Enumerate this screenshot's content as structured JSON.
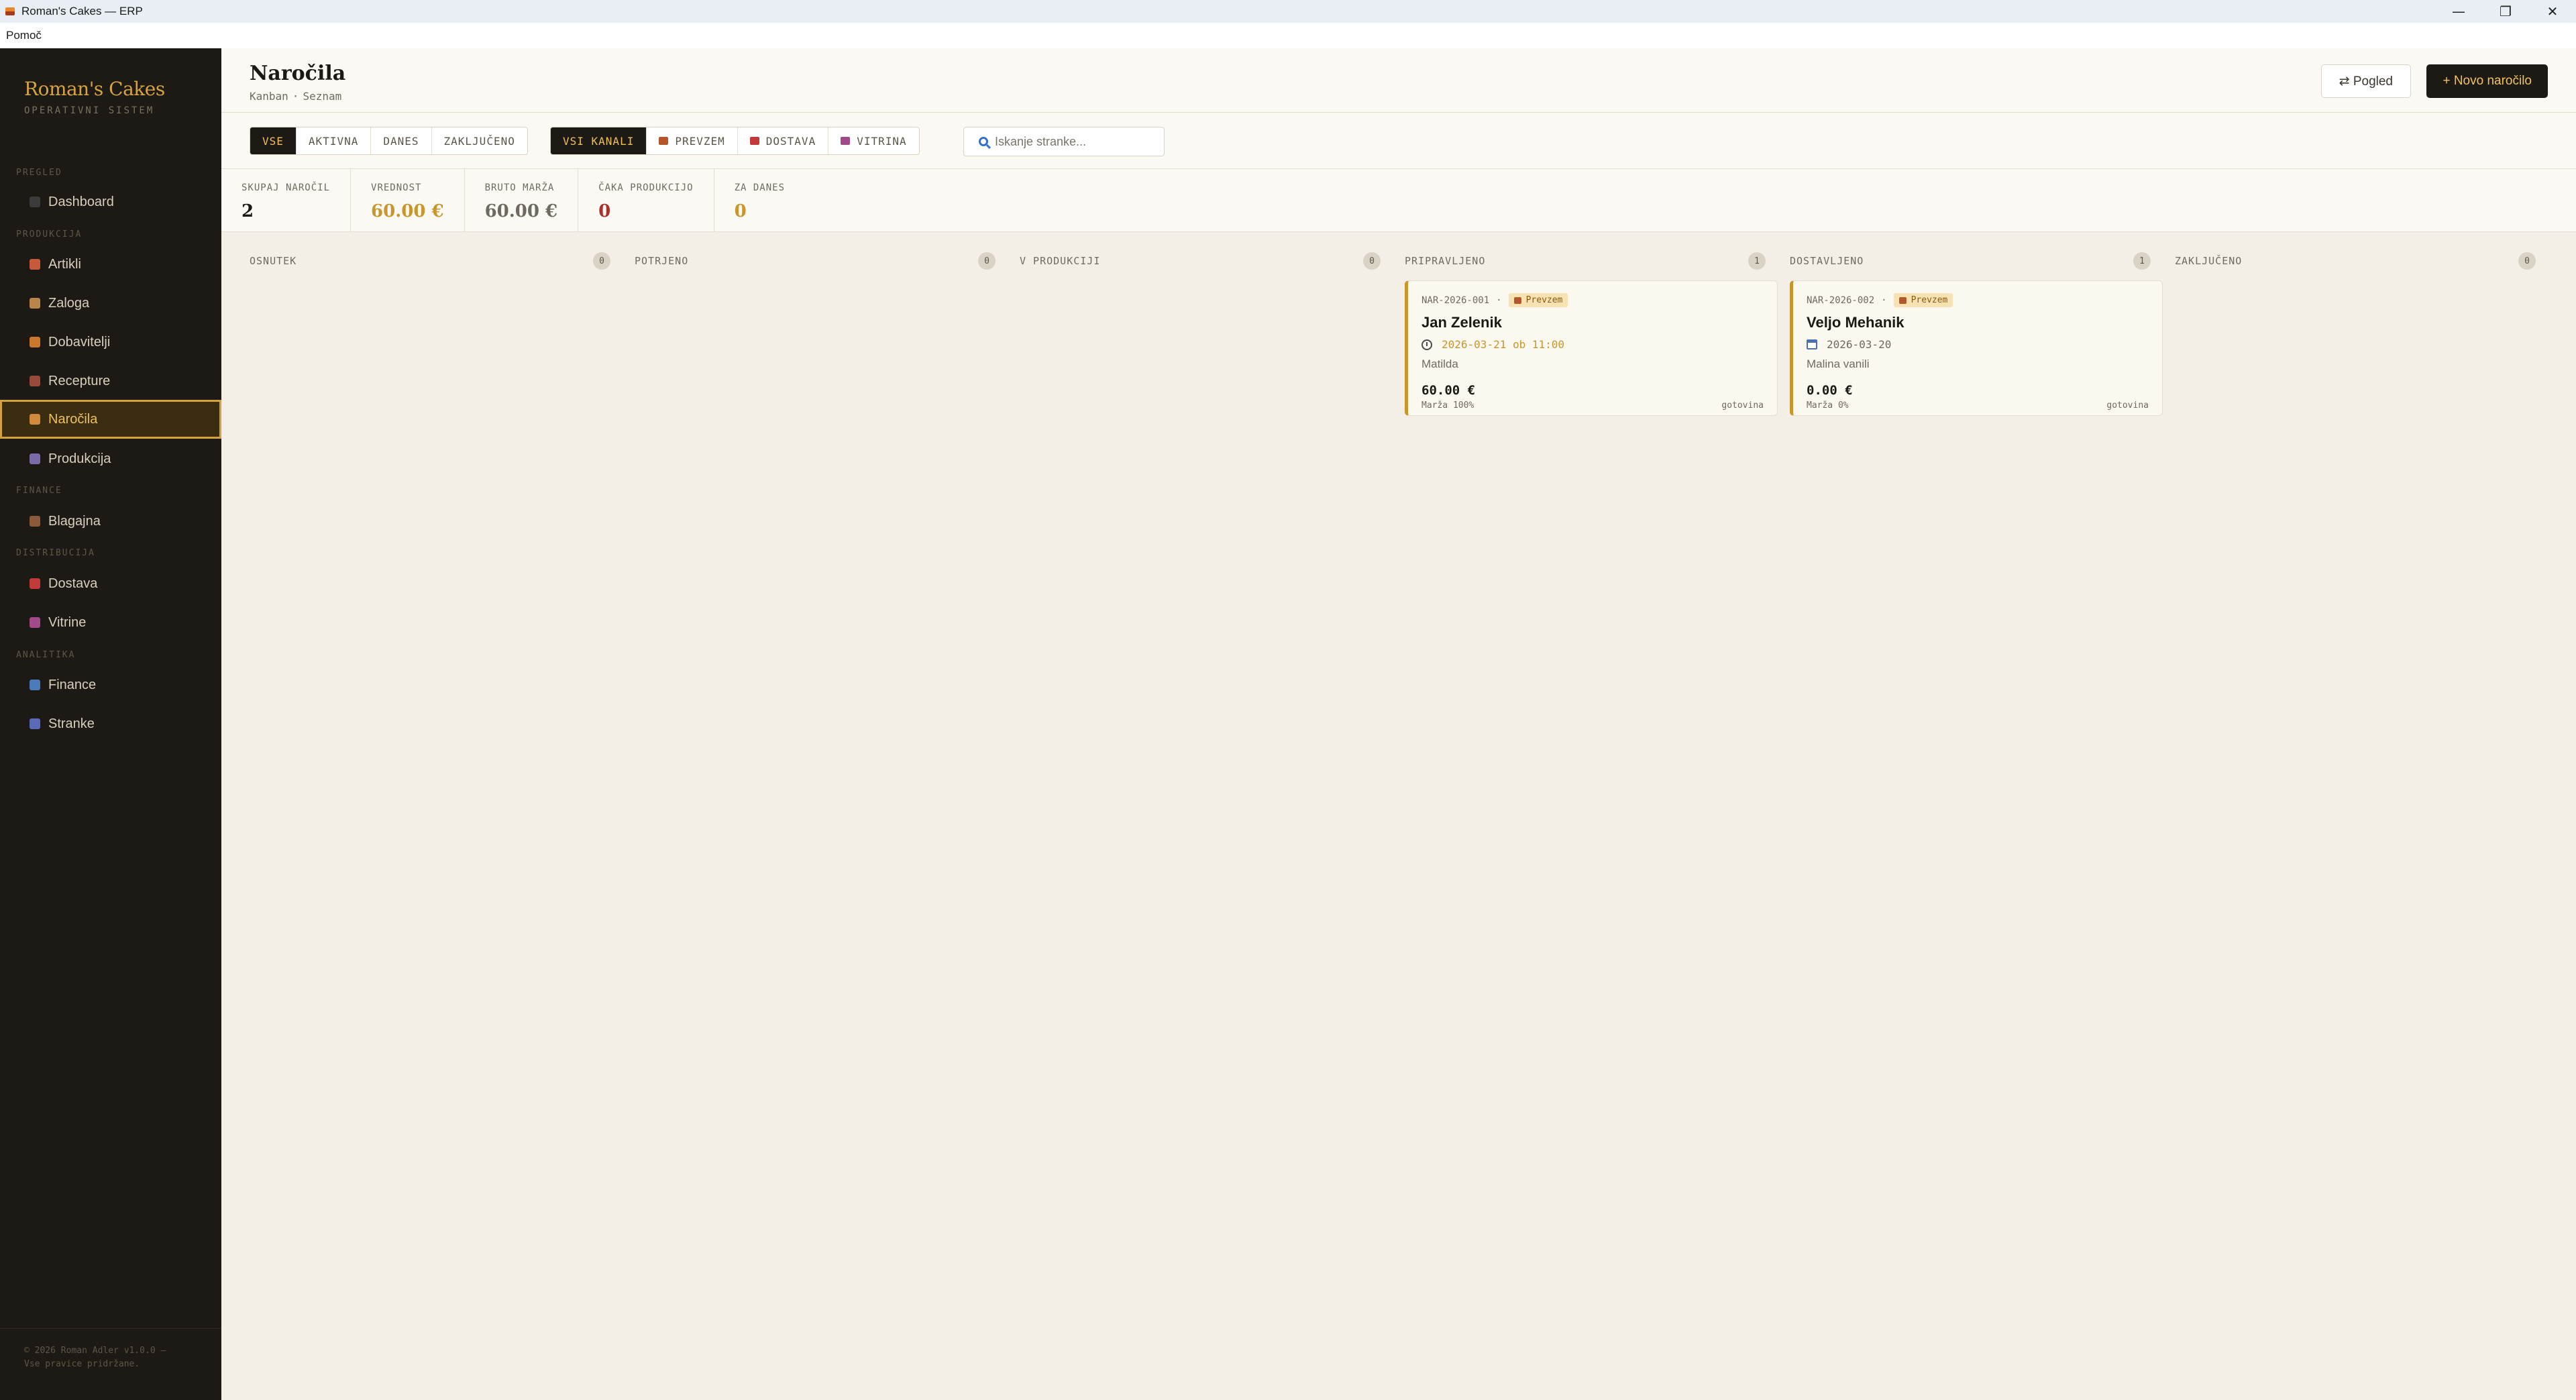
{
  "window": {
    "title": "Roman's Cakes — ERP",
    "minimize": "—",
    "maximize": "❐",
    "close": "✕"
  },
  "menu": {
    "help": "Pomoč"
  },
  "brand": {
    "name": "Roman's Cakes",
    "subtitle": "OPERATIVNI SISTEM"
  },
  "sidebar": {
    "sections": [
      {
        "label": "PREGLED"
      },
      {
        "label": "PRODUKCIJA"
      },
      {
        "label": "FINANCE"
      },
      {
        "label": "DISTRIBUCIJA"
      },
      {
        "label": "ANALITIKA"
      }
    ],
    "items": [
      {
        "label": "Dashboard",
        "icon": "dashboard-icon",
        "color": "#3b3b3b"
      },
      {
        "label": "Artikli",
        "icon": "cake-icon",
        "color": "#c65a3a"
      },
      {
        "label": "Zaloga",
        "icon": "box-icon",
        "color": "#b8864a"
      },
      {
        "label": "Dobavitelji",
        "icon": "truck-icon",
        "color": "#c9782c"
      },
      {
        "label": "Recepture",
        "icon": "book-icon",
        "color": "#9a4a3a"
      },
      {
        "label": "Naročila",
        "icon": "basket-icon",
        "color": "#d08a3a",
        "active": true
      },
      {
        "label": "Produkcija",
        "icon": "factory-icon",
        "color": "#7a6aa8"
      },
      {
        "label": "Blagajna",
        "icon": "ledger-icon",
        "color": "#8a5a3a"
      },
      {
        "label": "Dostava",
        "icon": "car-icon",
        "color": "#c23a3a"
      },
      {
        "label": "Vitrine",
        "icon": "store-icon",
        "color": "#a04a8a"
      },
      {
        "label": "Finance",
        "icon": "chart-icon",
        "color": "#4a7ab8"
      },
      {
        "label": "Stranke",
        "icon": "people-icon",
        "color": "#5a6ab8"
      }
    ],
    "copyright": "© 2026 Roman Adler v1.0.0 — Vse pravice pridržane."
  },
  "header": {
    "title": "Naročila",
    "views": [
      "Kanban",
      "Seznam"
    ],
    "view_sep": "·",
    "pogled_button": "⇄ Pogled",
    "new_button": "+ Novo naročilo"
  },
  "filters": {
    "status": [
      "VSE",
      "AKTIVNA",
      "DANES",
      "ZAKLJUČENO"
    ],
    "status_active": "VSE",
    "channels": [
      {
        "label": "VSI KANALI",
        "icon": null
      },
      {
        "label": "PREVZEM",
        "icon": "shop-icon",
        "color": "#b5552a"
      },
      {
        "label": "DOSTAVA",
        "icon": "car-icon",
        "color": "#c23a3a"
      },
      {
        "label": "VITRINA",
        "icon": "store-icon",
        "color": "#a04a8a"
      }
    ],
    "channel_active": "VSI KANALI",
    "search_placeholder": "Iskanje stranke..."
  },
  "stats": [
    {
      "label": "SKUPAJ NAROČIL",
      "value": "2",
      "color": "#1c1915"
    },
    {
      "label": "VREDNOST",
      "value": "60.00 €",
      "color": "#c9962e"
    },
    {
      "label": "BRUTO MARŽA",
      "value": "60.00 €",
      "color": "#6f6a5f"
    },
    {
      "label": "ČAKA PRODUKCIJO",
      "value": "0",
      "color": "#a8322a"
    },
    {
      "label": "ZA DANES",
      "value": "0",
      "color": "#c9962e"
    }
  ],
  "kanban": {
    "columns": [
      {
        "title": "OSNUTEK",
        "count": "0"
      },
      {
        "title": "POTRJENO",
        "count": "0"
      },
      {
        "title": "V PRODUKCIJI",
        "count": "0"
      },
      {
        "title": "PRIPRAVLJENO",
        "count": "1"
      },
      {
        "title": "DOSTAVLJENO",
        "count": "1"
      },
      {
        "title": "ZAKLJUČENO",
        "count": "0"
      }
    ],
    "cards": [
      {
        "column": "PRIPRAVLJENO",
        "id": "NAR-2026-001",
        "dot": "·",
        "channel": "Prevzem",
        "customer": "Jan Zelenik",
        "date": "2026-03-21 ob 11:00",
        "date_icon": "clock-icon",
        "date_color": "#c9962e",
        "item": "Matilda",
        "price": "60.00 €",
        "margin": "Marža 100%",
        "payment": "gotovina"
      },
      {
        "column": "DOSTAVLJENO",
        "id": "NAR-2026-002",
        "dot": "·",
        "channel": "Prevzem",
        "customer": "Veljo Mehanik",
        "date": "2026-03-20",
        "date_icon": "calendar-icon",
        "date_color": "#6f6a5f",
        "item": "Malina vanili",
        "price": "0.00 €",
        "margin": "Marža 0%",
        "payment": "gotovina"
      }
    ]
  }
}
